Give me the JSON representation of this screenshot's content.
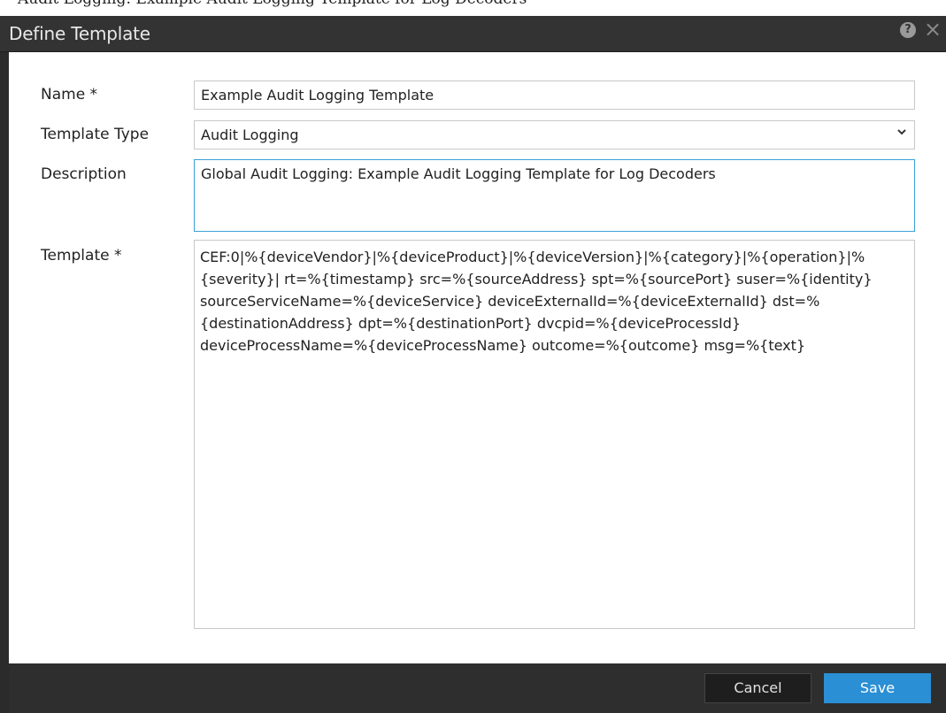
{
  "header_strip_text": "Audit Logging: Example Audit Logging Template for Log Decoders",
  "dialog": {
    "title": "Define Template",
    "help_icon_glyph": "?",
    "close_icon_glyph": "×"
  },
  "form": {
    "name_label": "Name *",
    "name_value": "Example Audit Logging Template",
    "type_label": "Template Type",
    "type_value": "Audit Logging",
    "description_label": "Description",
    "description_value": "Global Audit Logging: Example Audit Logging Template for Log Decoders",
    "template_label": "Template *",
    "template_value": "CEF:0|%{deviceVendor}|%{deviceProduct}|%{deviceVersion}|%{category}|%{operation}|%{severity}| rt=%{timestamp} src=%{sourceAddress} spt=%{sourcePort} suser=%{identity} sourceServiceName=%{deviceService} deviceExternalId=%{deviceExternalId} dst=%{destinationAddress} dpt=%{destinationPort} dvcpid=%{deviceProcessId} deviceProcessName=%{deviceProcessName} outcome=%{outcome} msg=%{text}"
  },
  "footer": {
    "cancel_label": "Cancel",
    "save_label": "Save"
  },
  "colors": {
    "titlebar": "#333333",
    "footer": "#2e2e2e",
    "save_button": "#2a8fd4",
    "focus_border": "#3aa0d8"
  }
}
